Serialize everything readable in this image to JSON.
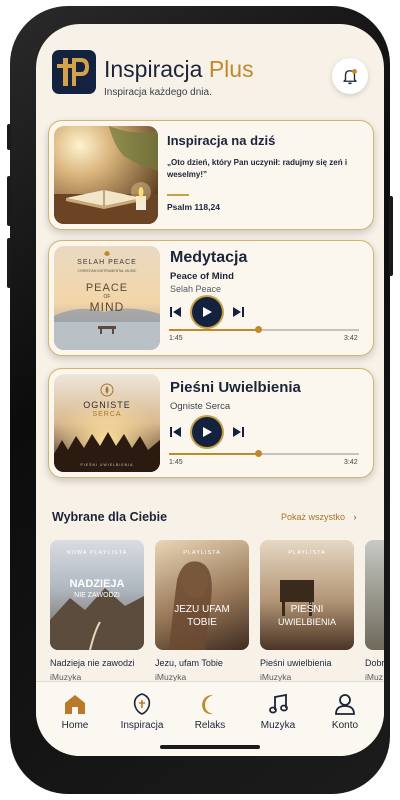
{
  "header": {
    "logo_letters": "TP",
    "title_main": "Inspiracja",
    "title_accent": "Plus",
    "tagline": "Inspiracja każdego dnia."
  },
  "daily": {
    "title": "Inspiracja na dziś",
    "quote": "„Oto dzień, który Pan uczynił: radujmy się zeń i weselmy!”",
    "reference": "Psalm 118,24"
  },
  "meditation": {
    "title": "Medytacja",
    "track": "Peace of Mind",
    "artist": "Selah Peace",
    "cover_top": "SELAH PEACE",
    "cover_small": "CHRISTIAN INSTRUMENTAL MUSIC",
    "cover_main_1": "PEACE",
    "cover_main_of": "OF",
    "cover_main_2": "MIND",
    "time_current": "1:45",
    "time_total": "3:42",
    "progress": 0.47
  },
  "worship": {
    "title": "Pieśni Uwielbienia",
    "artist": "Ogniste Serca",
    "cover_line1": "OGNISTE",
    "cover_line2": "SERCA",
    "cover_small": "PIEŚNI UWIELBIENIA",
    "time_current": "1:45",
    "time_total": "3:42",
    "progress": 0.47
  },
  "recommended": {
    "title": "Wybrane dla Ciebie",
    "see_all": "Pokaż wszystko",
    "items": [
      {
        "tag": "NOWA PLAYLISTA",
        "cover_1": "NADZIEJA",
        "cover_2": "NIE ZAWODZI",
        "name": "Nadzieja nie zawodzi",
        "subtitle": "iMuzyka"
      },
      {
        "tag": "PLAYLISTA",
        "cover_1": "JEZU UFAM",
        "cover_2": "TOBIE",
        "name": "Jezu, ufam Tobie",
        "subtitle": "iMuzyka"
      },
      {
        "tag": "PLAYLISTA",
        "cover_1": "PIEŚNI",
        "cover_2": "UWIELBIENIA",
        "name": "Pieśni uwielbienia",
        "subtitle": "iMuzyka"
      },
      {
        "tag": "",
        "cover_1": "",
        "cover_2": "",
        "name": "Dobr",
        "subtitle": "iMuz"
      }
    ]
  },
  "nav": {
    "items": [
      {
        "label": "Home",
        "icon": "home-icon"
      },
      {
        "label": "Inspiracja",
        "icon": "inspiration-icon"
      },
      {
        "label": "Relaks",
        "icon": "moon-icon"
      },
      {
        "label": "Muzyka",
        "icon": "music-note-icon"
      },
      {
        "label": "Konto",
        "icon": "user-icon"
      }
    ]
  },
  "colors": {
    "navy": "#13233f",
    "gold": "#c08a2a",
    "background": "#f7f1e8"
  }
}
